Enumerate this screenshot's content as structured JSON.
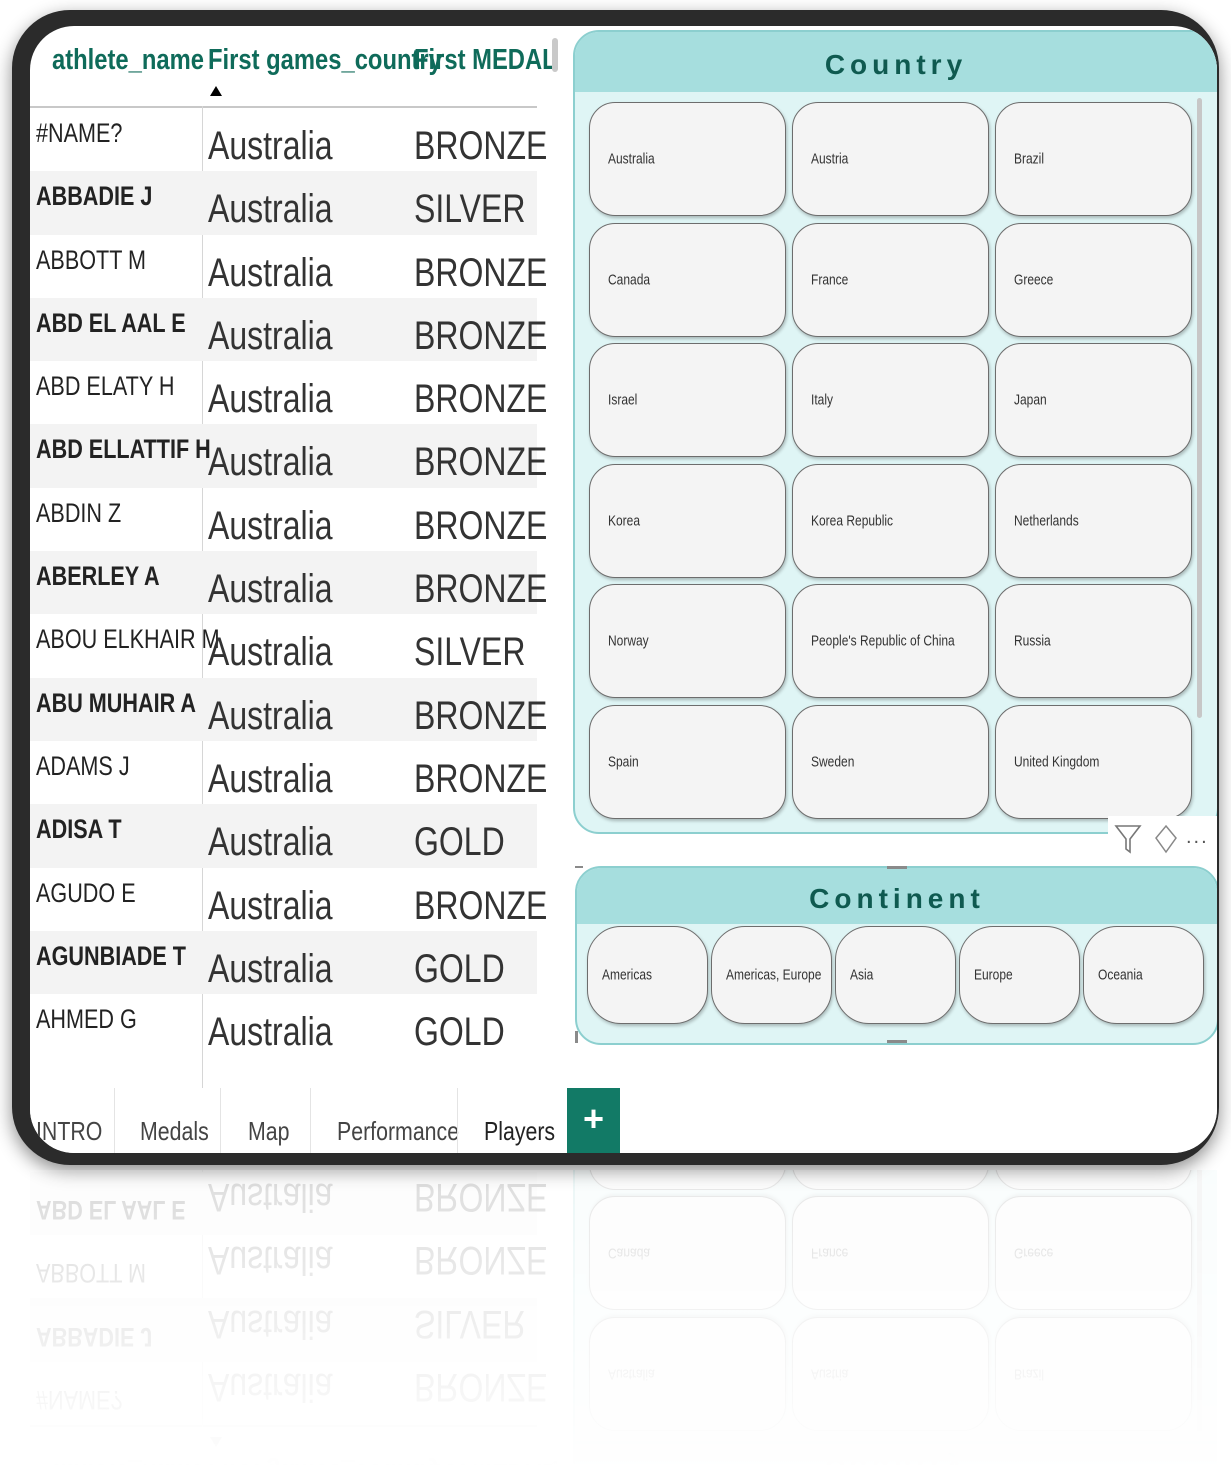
{
  "table": {
    "headers": [
      "athlete_name",
      "First games_country",
      "First MEDAL"
    ],
    "rows": [
      {
        "name": "#NAME?",
        "country": "Australia",
        "medal": "BRONZE",
        "bold": false
      },
      {
        "name": "ABBADIE J",
        "country": "Australia",
        "medal": "SILVER",
        "bold": true
      },
      {
        "name": "ABBOTT M",
        "country": "Australia",
        "medal": "BRONZE",
        "bold": false
      },
      {
        "name": "ABD EL AAL E",
        "country": "Australia",
        "medal": "BRONZE",
        "bold": true
      },
      {
        "name": "ABD ELATY H",
        "country": "Australia",
        "medal": "BRONZE",
        "bold": false
      },
      {
        "name": "ABD ELLATTIF H",
        "country": "Australia",
        "medal": "BRONZE",
        "bold": true
      },
      {
        "name": "ABDIN Z",
        "country": "Australia",
        "medal": "BRONZE",
        "bold": false
      },
      {
        "name": "ABERLEY A",
        "country": "Australia",
        "medal": "BRONZE",
        "bold": true
      },
      {
        "name": "ABOU ELKHAIR M",
        "country": "Australia",
        "medal": "SILVER",
        "bold": false
      },
      {
        "name": "ABU MUHAIR A",
        "country": "Australia",
        "medal": "BRONZE",
        "bold": true
      },
      {
        "name": "ADAMS J",
        "country": "Australia",
        "medal": "BRONZE",
        "bold": false
      },
      {
        "name": "ADISA T",
        "country": "Australia",
        "medal": "GOLD",
        "bold": true
      },
      {
        "name": "AGUDO E",
        "country": "Australia",
        "medal": "BRONZE",
        "bold": false
      },
      {
        "name": "AGUNBIADE T",
        "country": "Australia",
        "medal": "GOLD",
        "bold": true
      },
      {
        "name": "AHMED G",
        "country": "Australia",
        "medal": "GOLD",
        "bold": false
      }
    ]
  },
  "tabs": [
    "INTRO",
    "Medals",
    "Map",
    "Performance",
    "Players"
  ],
  "add_tab_label": "+",
  "country_slicer": {
    "title": "Country",
    "items": [
      "Australia",
      "Austria",
      "Brazil",
      "Canada",
      "France",
      "Greece",
      "Israel",
      "Italy",
      "Japan",
      "Korea",
      "Korea Republic",
      "Netherlands",
      "Norway",
      "People's Republic of China",
      "Russia",
      "Spain",
      "Sweden",
      "United Kingdom"
    ]
  },
  "continent_slicer": {
    "title": "Continent",
    "items": [
      "Americas",
      "Americas, Europe",
      "Asia",
      "Europe",
      "Oceania"
    ]
  },
  "visual_header": {
    "more_label": "..."
  },
  "colors": {
    "accent": "#127a66",
    "header_text": "#0f6b5a",
    "slicer_header": "#a6dede",
    "slicer_bg": "#dff5f5"
  }
}
